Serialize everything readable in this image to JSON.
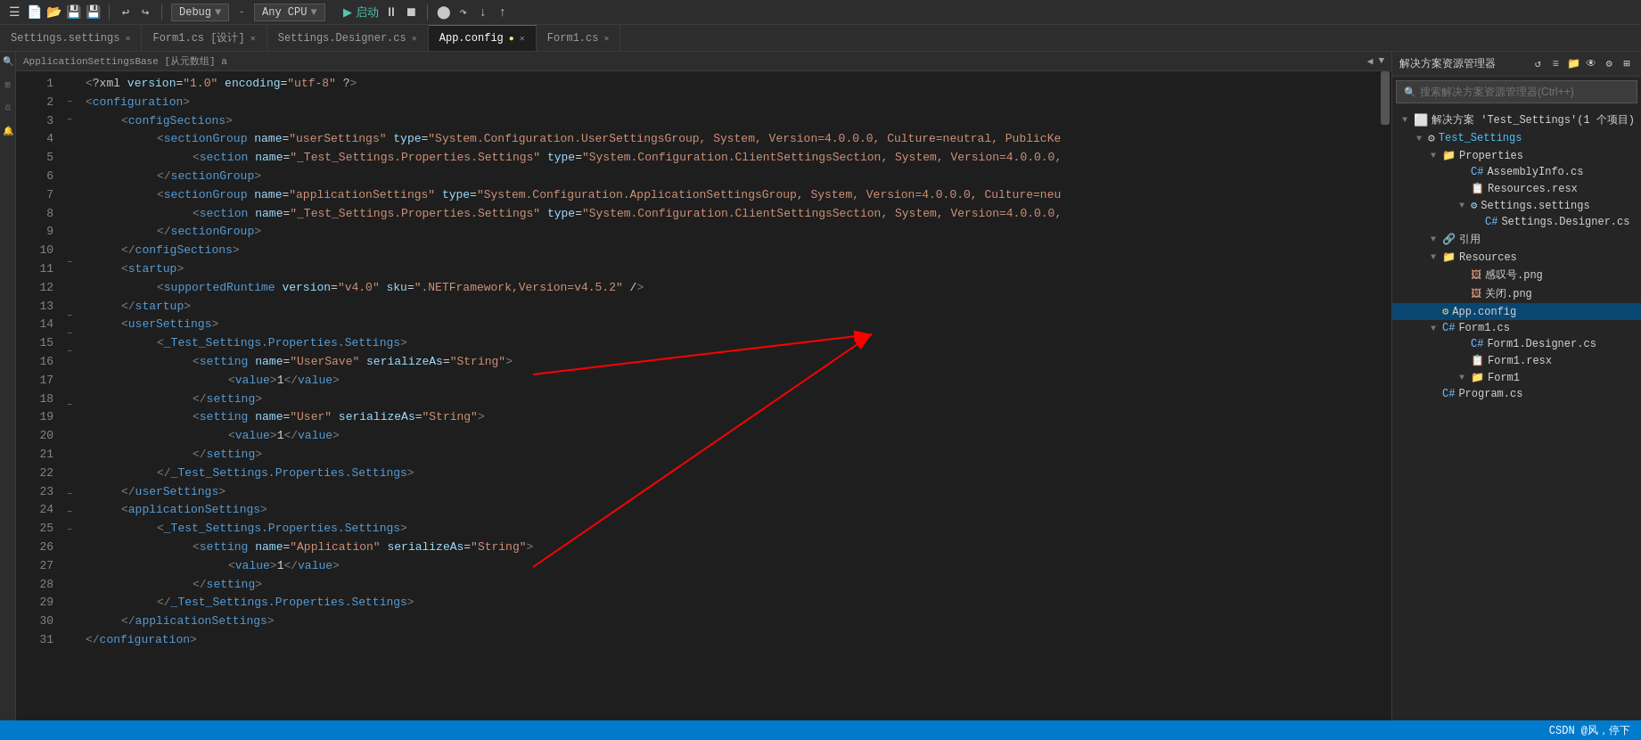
{
  "toolbar": {
    "debug_label": "Debug",
    "cpu_label": "Any CPU",
    "run_label": "启动",
    "icons": [
      "↩",
      "↪",
      "▶",
      "⏹",
      "⏸"
    ]
  },
  "tabs": [
    {
      "label": "Settings.settings",
      "modified": false,
      "active": false
    },
    {
      "label": "Form1.cs [设计]",
      "modified": false,
      "active": false
    },
    {
      "label": "Settings.Designer.cs",
      "modified": false,
      "active": false
    },
    {
      "label": "App.config",
      "modified": true,
      "active": true
    },
    {
      "label": "Form1.cs",
      "modified": false,
      "active": false
    }
  ],
  "info_bar": {
    "left": "ApplicationSettingsBase [从元数组] а",
    "right": ""
  },
  "code": {
    "lines": [
      {
        "num": 1,
        "indent": 0,
        "content": "<?xml version=\"1.0\" encoding=\"utf-8\" ?>"
      },
      {
        "num": 2,
        "indent": 0,
        "content": "<configuration>"
      },
      {
        "num": 3,
        "indent": 1,
        "content": "<configSections>"
      },
      {
        "num": 4,
        "indent": 2,
        "content": "<sectionGroup name=\"userSettings\" type=\"System.Configuration.UserSettingsGroup, System, Version=4.0.0.0, Culture=neutral, PublicKe"
      },
      {
        "num": 5,
        "indent": 3,
        "content": "<section name=\"_Test_Settings.Properties.Settings\" type=\"System.Configuration.ClientSettingsSection, System, Version=4.0.0.0,"
      },
      {
        "num": 6,
        "indent": 2,
        "content": "</sectionGroup>"
      },
      {
        "num": 7,
        "indent": 2,
        "content": "<sectionGroup name=\"applicationSettings\" type=\"System.Configuration.ApplicationSettingsGroup, System, Version=4.0.0.0, Culture=neu"
      },
      {
        "num": 8,
        "indent": 3,
        "content": "<section name=\"_Test_Settings.Properties.Settings\" type=\"System.Configuration.ClientSettingsSection, System, Version=4.0.0.0,"
      },
      {
        "num": 9,
        "indent": 2,
        "content": "</sectionGroup>"
      },
      {
        "num": 10,
        "indent": 1,
        "content": "</configSections>"
      },
      {
        "num": 11,
        "indent": 1,
        "content": "<startup>"
      },
      {
        "num": 12,
        "indent": 2,
        "content": "<supportedRuntime version=\"v4.0\" sku=\".NETFramework,Version=v4.5.2\" />"
      },
      {
        "num": 13,
        "indent": 1,
        "content": "</startup>"
      },
      {
        "num": 14,
        "indent": 1,
        "content": "<userSettings>"
      },
      {
        "num": 15,
        "indent": 2,
        "content": "<_Test_Settings.Properties.Settings>"
      },
      {
        "num": 16,
        "indent": 3,
        "content": "<setting name=\"UserSave\" serializeAs=\"String\">"
      },
      {
        "num": 17,
        "indent": 4,
        "content": "<value>1</value>"
      },
      {
        "num": 18,
        "indent": 3,
        "content": "</setting>"
      },
      {
        "num": 19,
        "indent": 3,
        "content": "<setting name=\"User\" serializeAs=\"String\">"
      },
      {
        "num": 20,
        "indent": 4,
        "content": "<value>1</value>"
      },
      {
        "num": 21,
        "indent": 3,
        "content": "</setting>"
      },
      {
        "num": 22,
        "indent": 2,
        "content": "</_Test_Settings.Properties.Settings>"
      },
      {
        "num": 23,
        "indent": 1,
        "content": "</userSettings>"
      },
      {
        "num": 24,
        "indent": 1,
        "content": "<applicationSettings>"
      },
      {
        "num": 25,
        "indent": 2,
        "content": "<_Test_Settings.Properties.Settings>"
      },
      {
        "num": 26,
        "indent": 3,
        "content": "<setting name=\"Application\" serializeAs=\"String\">"
      },
      {
        "num": 27,
        "indent": 4,
        "content": "<value>1</value>"
      },
      {
        "num": 28,
        "indent": 3,
        "content": "</setting>"
      },
      {
        "num": 29,
        "indent": 2,
        "content": "</_Test_Settings.Properties.Settings>"
      },
      {
        "num": 30,
        "indent": 1,
        "content": "</applicationSettings>"
      },
      {
        "num": 31,
        "indent": 0,
        "content": "</configuration>"
      }
    ]
  },
  "solution_explorer": {
    "title": "解决方案资源管理器",
    "search_placeholder": "搜索解决方案资源管理器(Ctrl++)",
    "tree": [
      {
        "level": 0,
        "expand": "▼",
        "icon": "solution",
        "label": "解决方案 'Test_Settings'(1 个项目)"
      },
      {
        "level": 1,
        "expand": "▼",
        "icon": "project",
        "label": "Test_Settings"
      },
      {
        "level": 2,
        "expand": "▼",
        "icon": "folder",
        "label": "Properties"
      },
      {
        "level": 3,
        "expand": " ",
        "icon": "cs",
        "label": "AssemblyInfo.cs"
      },
      {
        "level": 3,
        "expand": " ",
        "icon": "resx",
        "label": "Resources.resx"
      },
      {
        "level": 3,
        "expand": "▼",
        "icon": "settings",
        "label": "Settings.settings"
      },
      {
        "level": 4,
        "expand": " ",
        "icon": "cs",
        "label": "Settings.Designer.cs"
      },
      {
        "level": 2,
        "expand": "▼",
        "icon": "folder",
        "label": "引用"
      },
      {
        "level": 2,
        "expand": "▼",
        "icon": "folder",
        "label": "Resources"
      },
      {
        "level": 3,
        "expand": " ",
        "icon": "png",
        "label": "感叹号.png"
      },
      {
        "level": 3,
        "expand": " ",
        "icon": "png",
        "label": "关闭.png"
      },
      {
        "level": 2,
        "expand": " ",
        "icon": "config",
        "label": "App.config",
        "selected": true
      },
      {
        "level": 2,
        "expand": "▼",
        "icon": "cs",
        "label": "Form1.cs"
      },
      {
        "level": 3,
        "expand": " ",
        "icon": "cs",
        "label": "Form1.Designer.cs"
      },
      {
        "level": 3,
        "expand": " ",
        "icon": "resx",
        "label": "Form1.resx"
      },
      {
        "level": 3,
        "expand": "▼",
        "icon": "folder",
        "label": "Form1"
      },
      {
        "level": 2,
        "expand": " ",
        "icon": "cs",
        "label": "Program.cs"
      }
    ]
  },
  "status_bar": {
    "text": "CSDN @风，停下"
  }
}
